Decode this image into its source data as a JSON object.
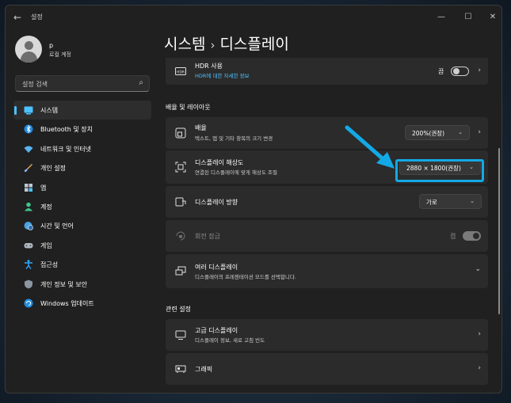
{
  "window": {
    "app_title": "설정"
  },
  "user": {
    "name": "p",
    "account_type": "로컬 계정"
  },
  "search": {
    "placeholder": "설정 검색"
  },
  "nav": [
    {
      "label": "시스템",
      "icon": "system-icon",
      "selected": true
    },
    {
      "label": "Bluetooth 및 장치",
      "icon": "bluetooth-icon"
    },
    {
      "label": "네트워크 및 인터넷",
      "icon": "wifi-icon"
    },
    {
      "label": "개인 설정",
      "icon": "brush-icon"
    },
    {
      "label": "앱",
      "icon": "apps-icon"
    },
    {
      "label": "계정",
      "icon": "account-icon"
    },
    {
      "label": "시간 및 언어",
      "icon": "globe-clock-icon"
    },
    {
      "label": "게임",
      "icon": "gamepad-icon"
    },
    {
      "label": "접근성",
      "icon": "accessibility-icon"
    },
    {
      "label": "개인 정보 및 보안",
      "icon": "shield-icon"
    },
    {
      "label": "Windows 업데이트",
      "icon": "update-icon"
    }
  ],
  "breadcrumb": {
    "parent": "시스템",
    "current": "디스플레이"
  },
  "hdr": {
    "title": "HDR 사용",
    "link": "HDR에 대한 자세한 정보",
    "toggle_label": "끔",
    "toggle_on": false
  },
  "layout_section": "배율 및 레이아웃",
  "scale": {
    "title": "배율",
    "sub": "텍스트, 앱 및 기타 항목의 크기 변경",
    "value": "200%(권장)"
  },
  "resolution": {
    "title": "디스플레이 해상도",
    "sub": "연결된 디스플레이에 맞게 해상도 조절",
    "value": "2880 × 1800(권장)"
  },
  "orientation": {
    "title": "디스플레이 방향",
    "value": "가로"
  },
  "rotation_lock": {
    "title": "회전 잠금",
    "toggle_label": "켬",
    "toggle_on": true,
    "disabled": true
  },
  "multi": {
    "title": "여러 디스플레이",
    "sub": "디스플레이의 프레젠테이션 모드를 선택합니다."
  },
  "related_section": "관련 설정",
  "advanced": {
    "title": "고급 디스플레이",
    "sub": "디스플레이 정보, 새로 고침 빈도"
  },
  "graphics": {
    "title": "그래픽"
  },
  "colors": {
    "accent": "#4cc2ff",
    "highlight": "#13a9e6"
  }
}
